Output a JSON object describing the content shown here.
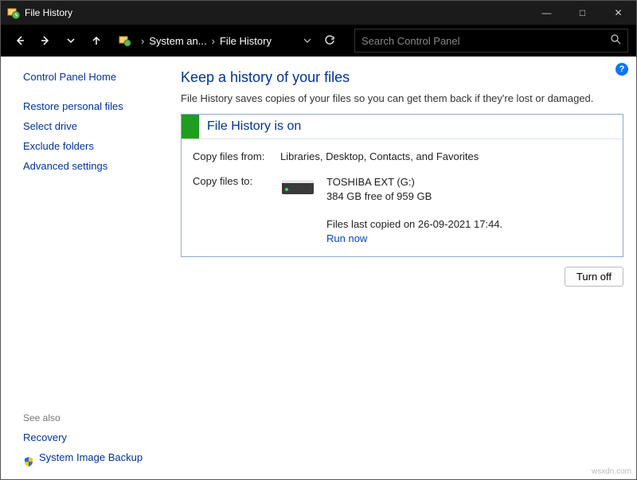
{
  "window": {
    "title": "File History",
    "controls": {
      "min": "—",
      "max": "□",
      "close": "✕"
    }
  },
  "nav": {
    "breadcrumb": {
      "seg1": "System an...",
      "seg2": "File History"
    },
    "search_placeholder": "Search Control Panel"
  },
  "sidebar": {
    "home": "Control Panel Home",
    "links": {
      "restore": "Restore personal files",
      "select_drive": "Select drive",
      "exclude": "Exclude folders",
      "advanced": "Advanced settings"
    },
    "see_also_label": "See also",
    "see_also": {
      "recovery": "Recovery",
      "image_backup": "System Image Backup"
    }
  },
  "main": {
    "title": "Keep a history of your files",
    "subtitle": "File History saves copies of your files so you can get them back if they're lost or damaged.",
    "status_header": "File History is on",
    "copy_from_label": "Copy files from:",
    "copy_from_value": "Libraries, Desktop, Contacts, and Favorites",
    "copy_to_label": "Copy files to:",
    "drive_name": "TOSHIBA EXT (G:)",
    "drive_space": "384 GB free of 959 GB",
    "last_copied": "Files last copied on 26-09-2021 17:44.",
    "run_now": "Run now",
    "turn_off": "Turn off"
  },
  "watermark": "wsxdn.com"
}
